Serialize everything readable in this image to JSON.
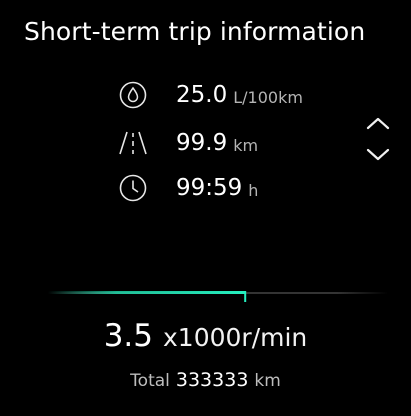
{
  "title": "Short-term trip information",
  "metrics": [
    {
      "icon": "fuel-drop-icon",
      "value": "25.0",
      "unit": "L/100km"
    },
    {
      "icon": "road-icon",
      "value": "99.9",
      "unit": "km"
    },
    {
      "icon": "clock-icon",
      "value": "99:59",
      "unit": "h"
    }
  ],
  "rpm": {
    "value": "3.5",
    "unit": "x1000r/min",
    "level": 0.58
  },
  "total": {
    "label": "Total",
    "value": "333333",
    "unit": "km"
  },
  "colors": {
    "background": "#000000",
    "accent": "#1fe0b0",
    "muted_text": "#b4b4b4"
  }
}
